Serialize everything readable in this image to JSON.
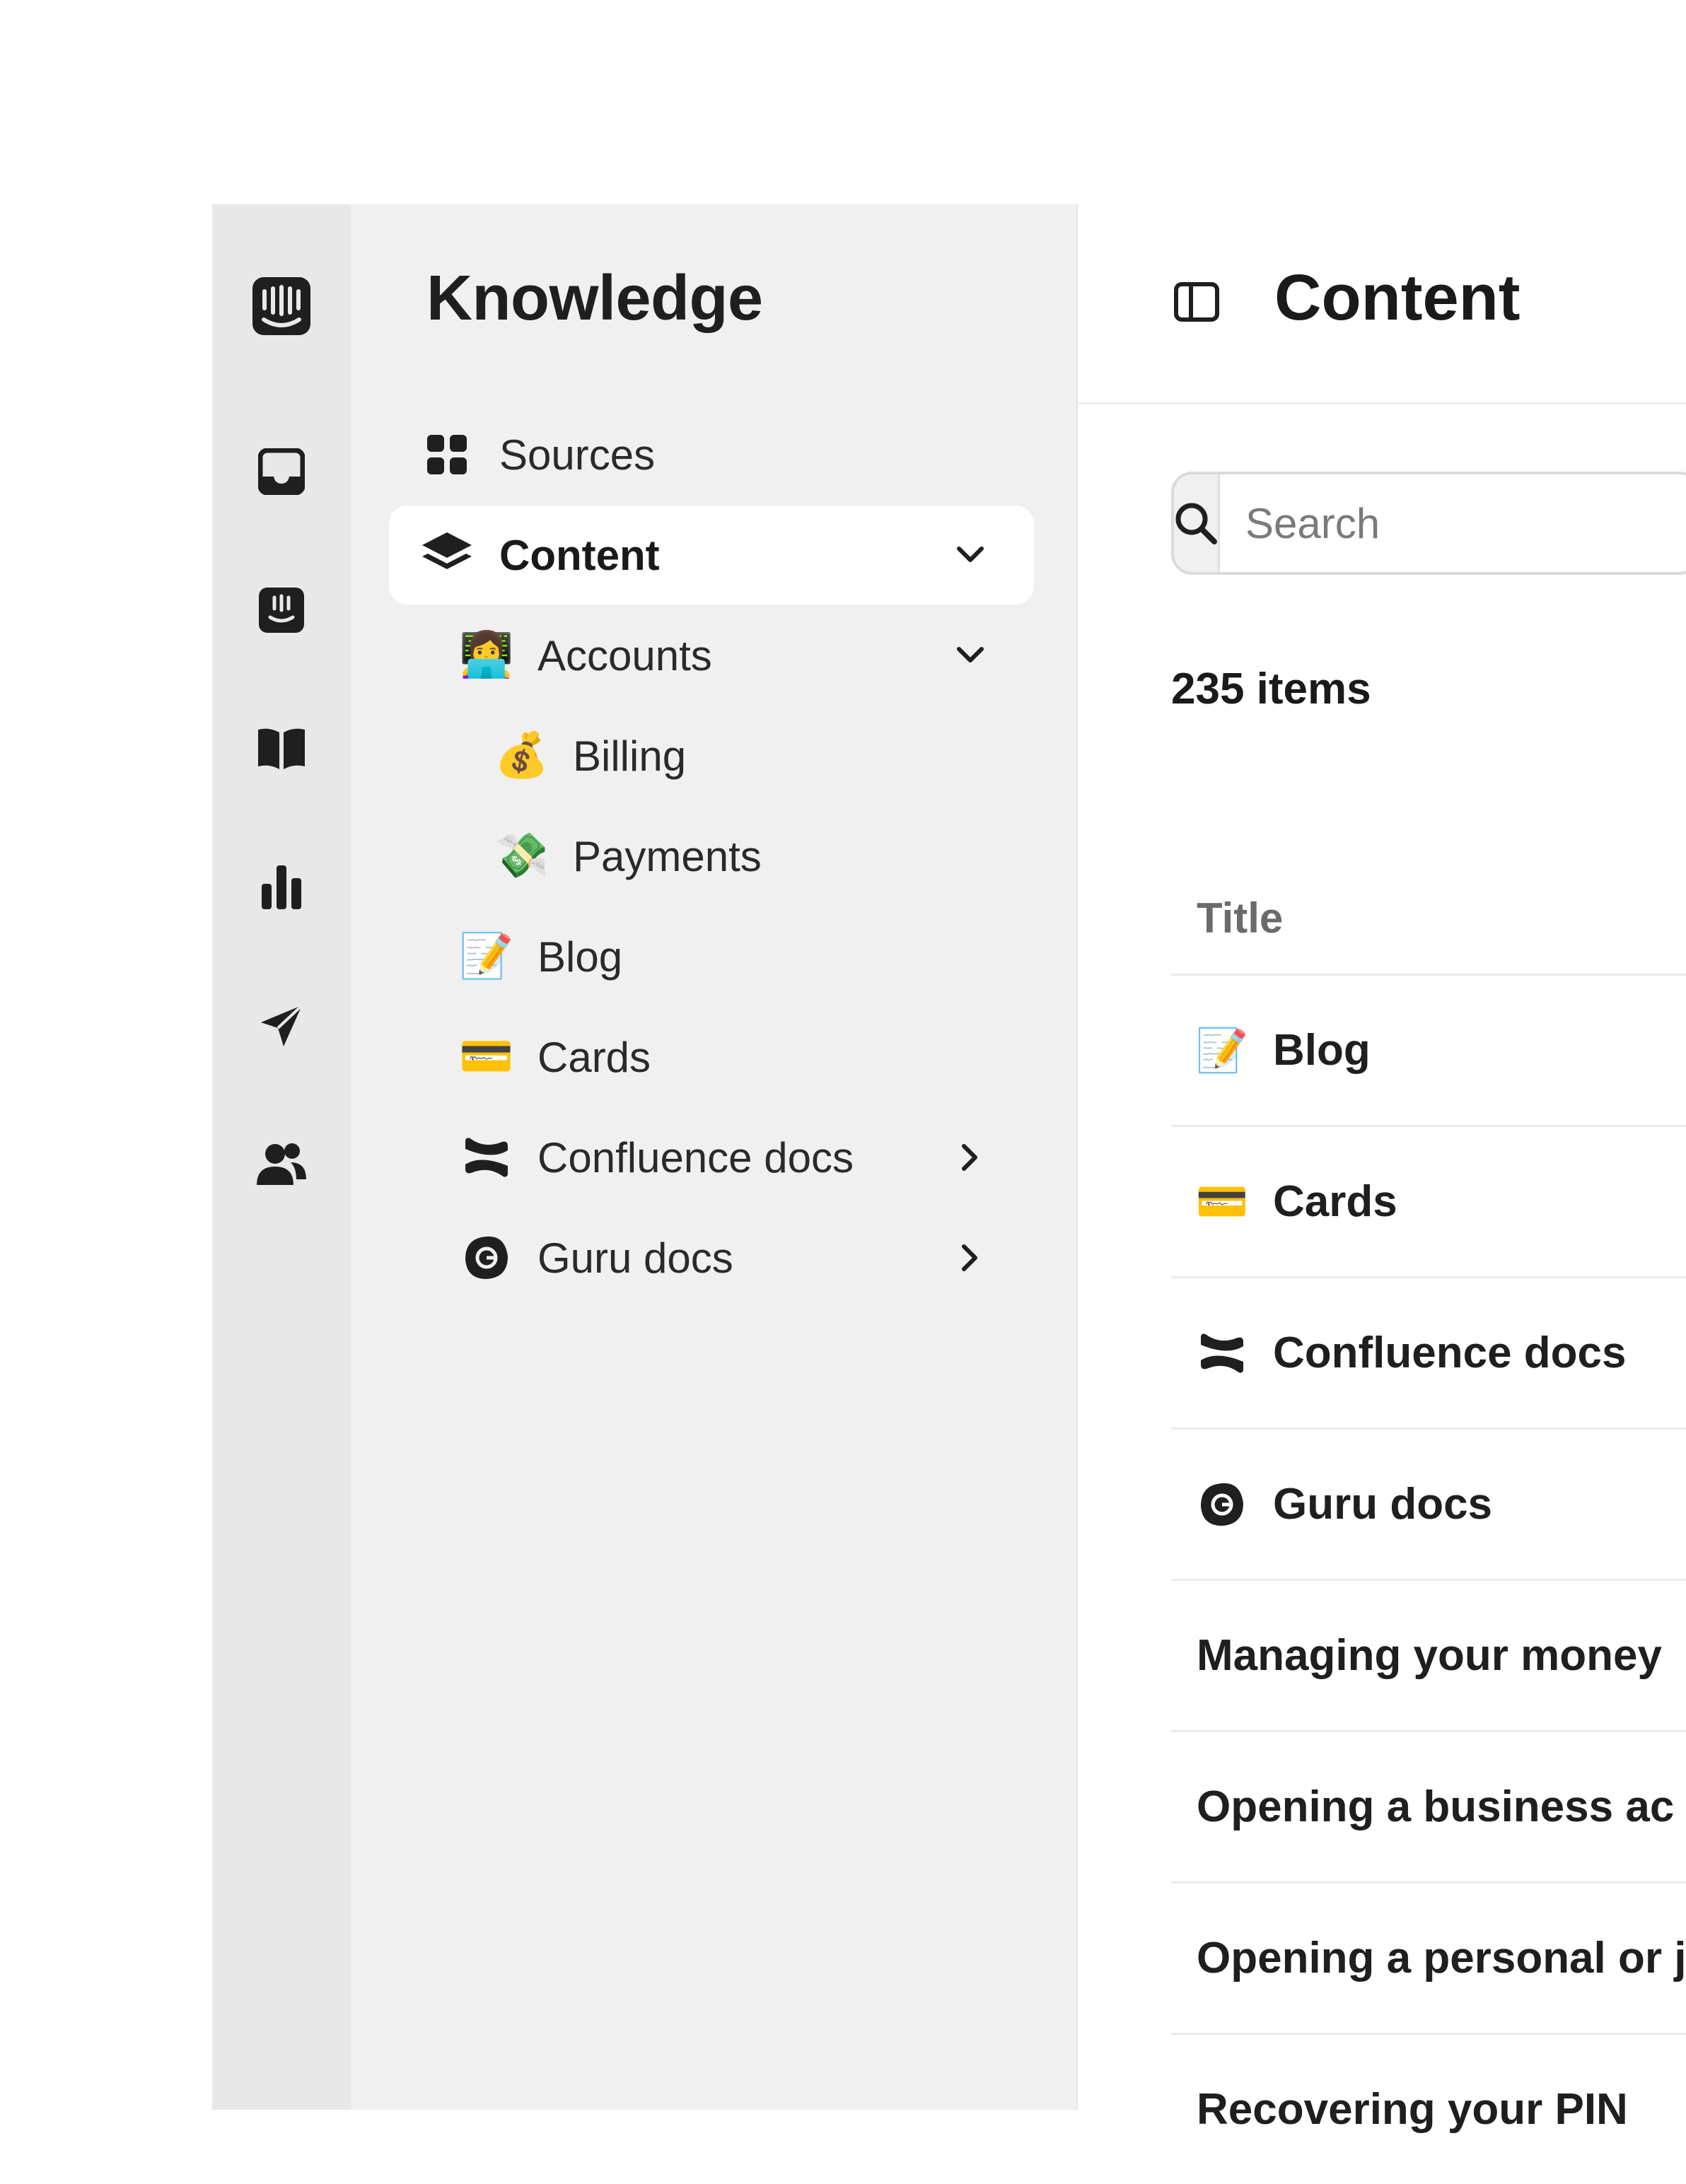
{
  "rail": {
    "icons": [
      "intercom-logo-icon",
      "inbox-icon",
      "fin-ai-icon",
      "knowledge-book-icon",
      "reports-chart-icon",
      "outbound-send-icon",
      "contacts-people-icon"
    ]
  },
  "knowledge": {
    "title": "Knowledge",
    "items": [
      {
        "label": "Sources",
        "icon": "grid-icon"
      },
      {
        "label": "Content",
        "icon": "layers-icon",
        "active": true
      },
      {
        "label": "Accounts",
        "icon": "person-laptop-emoji-icon"
      },
      {
        "label": "Billing",
        "icon": "money-bag-emoji-icon"
      },
      {
        "label": "Payments",
        "icon": "money-wings-emoji-icon"
      },
      {
        "label": "Blog",
        "icon": "memo-emoji-icon"
      },
      {
        "label": "Cards",
        "icon": "credit-card-emoji-icon"
      },
      {
        "label": "Confluence docs",
        "icon": "confluence-icon"
      },
      {
        "label": "Guru docs",
        "icon": "guru-icon"
      }
    ]
  },
  "main": {
    "title": "Content",
    "search_placeholder": "Search",
    "count": "235 items",
    "column_title": "Title",
    "rows": [
      {
        "label": "Blog",
        "icon": "memo-emoji-icon"
      },
      {
        "label": "Cards",
        "icon": "credit-card-emoji-icon"
      },
      {
        "label": "Confluence docs",
        "icon": "confluence-icon"
      },
      {
        "label": "Guru docs",
        "icon": "guru-icon"
      },
      {
        "label": "Managing your money"
      },
      {
        "label": "Opening a business ac"
      },
      {
        "label": "Opening a personal or j"
      },
      {
        "label": "Recovering your PIN"
      }
    ]
  },
  "emoji": {
    "accounts": "👩‍💻",
    "billing": "💰",
    "payments": "💸",
    "blog": "📝",
    "cards": "💳"
  },
  "colors": {
    "rail_bg": "#e8e8e8",
    "nav_bg": "#f0f0f0",
    "active_bg": "#ffffff",
    "text": "#1f1f1f",
    "muted": "#6b6b6b"
  }
}
